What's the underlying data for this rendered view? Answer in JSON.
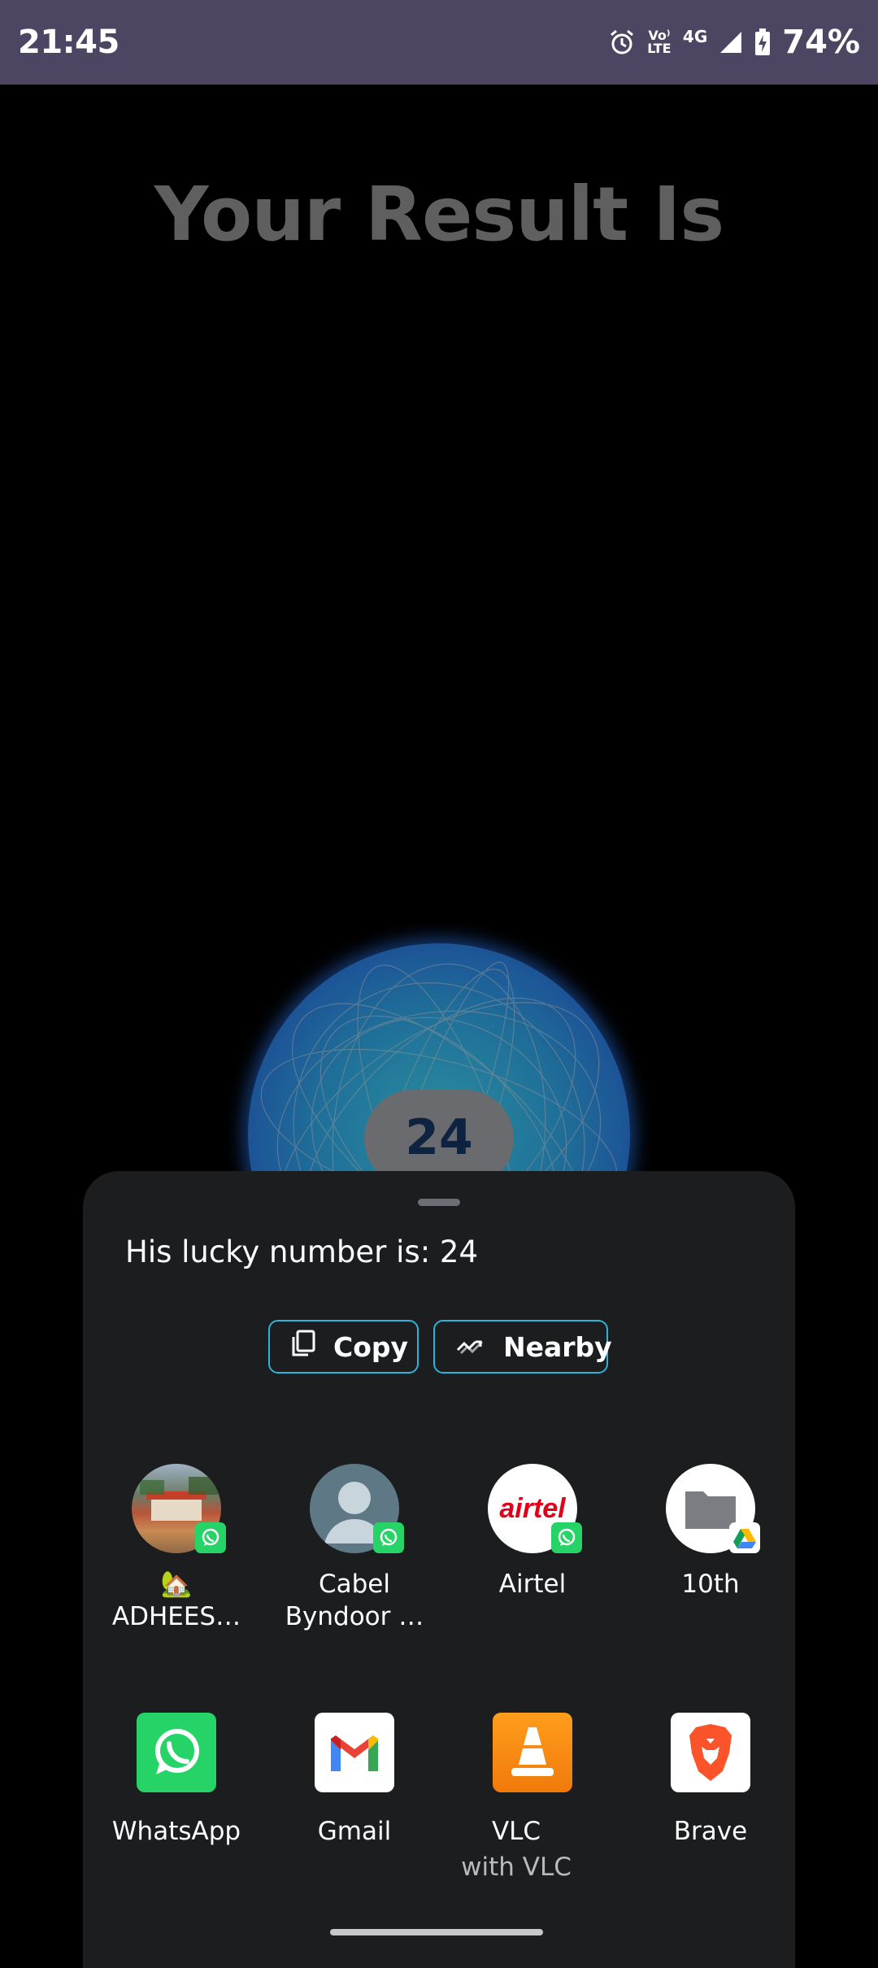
{
  "status_bar": {
    "time": "21:45",
    "network": "4G",
    "volte": "Vo⁾ LTE",
    "battery": "74%",
    "icons": [
      "alarm-icon",
      "volte-icon",
      "signal-icon",
      "battery-charging-icon"
    ]
  },
  "result": {
    "title": "Your Result Is",
    "number": "24"
  },
  "share_sheet": {
    "text": "His lucky number is: 24",
    "actions": [
      {
        "label": "Copy",
        "icon": "copy-icon"
      },
      {
        "label": "Nearby",
        "icon": "nearby-share-icon"
      }
    ],
    "direct_targets": [
      {
        "label_line1": "🏡",
        "label_line2": "ADHEES…",
        "badge": "whatsapp-badge-icon"
      },
      {
        "label_line1": "Cabel",
        "label_line2": "Byndoor …",
        "badge": "whatsapp-badge-icon"
      },
      {
        "label_line1": "Airtel",
        "label_line2": "",
        "avatar_text": "airtel",
        "badge": "whatsapp-badge-icon"
      },
      {
        "label_line1": "10th",
        "label_line2": "",
        "badge": "google-drive-badge-icon"
      }
    ],
    "apps": [
      {
        "label": "WhatsApp",
        "sub": "",
        "icon": "whatsapp-icon"
      },
      {
        "label": "Gmail",
        "sub": "",
        "icon": "gmail-icon"
      },
      {
        "label": "VLC",
        "sub": "with VLC",
        "icon": "vlc-icon"
      },
      {
        "label": "Brave",
        "sub": "",
        "icon": "brave-icon"
      }
    ]
  },
  "colors": {
    "status_bar_bg": "#4c4663",
    "sheet_bg": "#1b1d1f",
    "chip_border": "#2fb3d9",
    "whatsapp_green": "#25d366"
  }
}
